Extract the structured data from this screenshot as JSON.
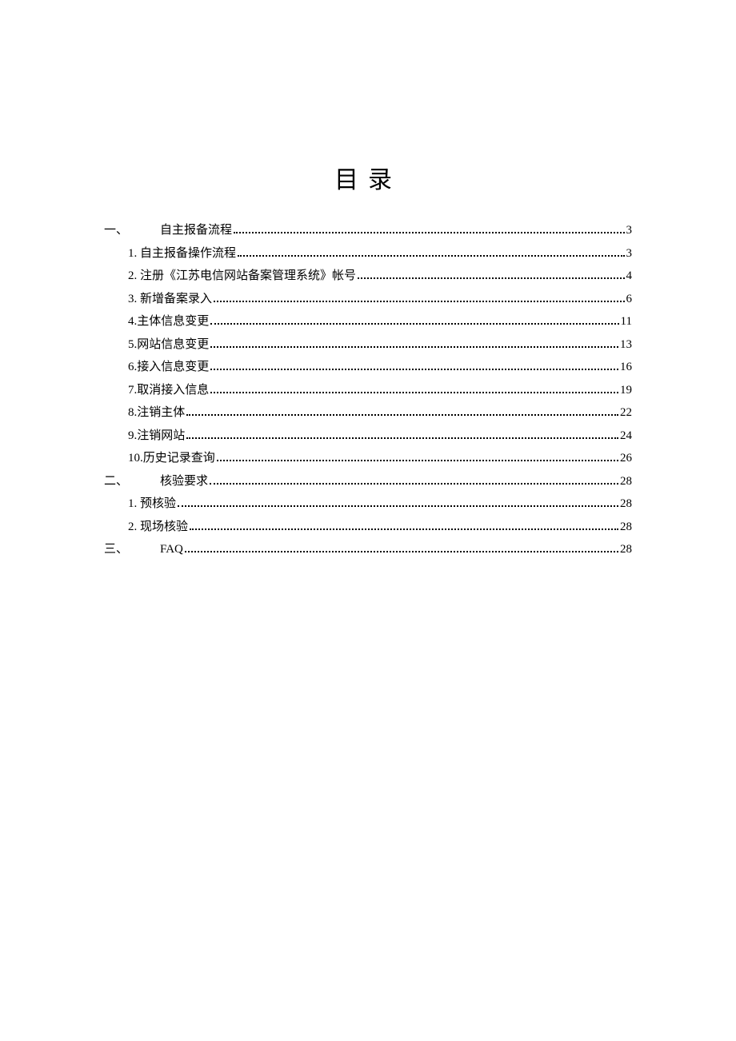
{
  "title": "目录",
  "toc": [
    {
      "level": 1,
      "marker": "一、",
      "label": "自主报备流程",
      "page": "3"
    },
    {
      "level": 2,
      "marker": "",
      "label": "1. 自主报备操作流程",
      "page": "3"
    },
    {
      "level": 2,
      "marker": "",
      "label": "2. 注册《江苏电信网站备案管理系统》帐号",
      "page": "4"
    },
    {
      "level": 2,
      "marker": "",
      "label": "3. 新增备案录入",
      "page": "6"
    },
    {
      "level": 2,
      "marker": "",
      "label": "4.主体信息变更",
      "page": "11"
    },
    {
      "level": 2,
      "marker": "",
      "label": "5.网站信息变更",
      "page": "13"
    },
    {
      "level": 2,
      "marker": "",
      "label": "6.接入信息变更",
      "page": "16"
    },
    {
      "level": 2,
      "marker": "",
      "label": "7.取消接入信息",
      "page": "19"
    },
    {
      "level": 2,
      "marker": "",
      "label": "8.注销主体",
      "page": "22"
    },
    {
      "level": 2,
      "marker": "",
      "label": "9.注销网站",
      "page": "24"
    },
    {
      "level": 2,
      "marker": "",
      "label": "10.历史记录查询",
      "page": "26"
    },
    {
      "level": 1,
      "marker": "二、",
      "label": "核验要求",
      "page": "28"
    },
    {
      "level": 2,
      "marker": "",
      "label": "1. 预核验",
      "page": "28"
    },
    {
      "level": 2,
      "marker": "",
      "label": "2. 现场核验",
      "page": "28"
    },
    {
      "level": 1,
      "marker": "三、",
      "label": "FAQ",
      "page": "28"
    }
  ]
}
